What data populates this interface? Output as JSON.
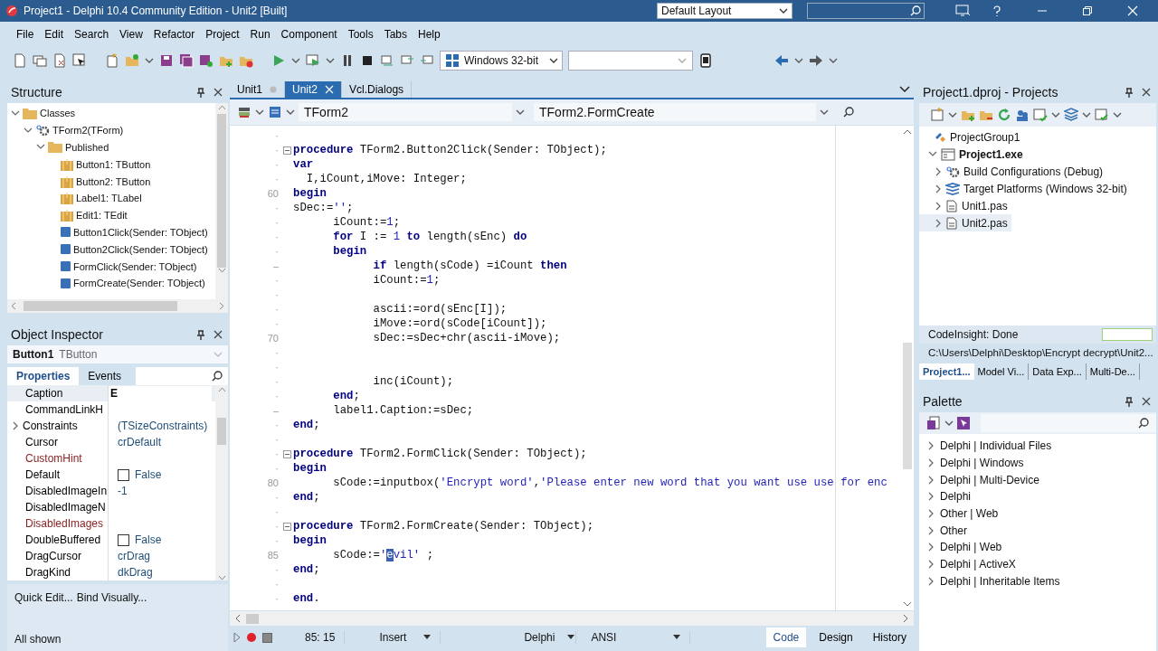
{
  "window": {
    "title": "Project1 - Delphi 10.4 Community Edition - Unit2 [Built]",
    "layout": "Default Layout"
  },
  "menu": [
    "File",
    "Edit",
    "Search",
    "View",
    "Refactor",
    "Project",
    "Run",
    "Component",
    "Tools",
    "Tabs",
    "Help"
  ],
  "toolbar": {
    "platform": "Windows 32-bit"
  },
  "structure": {
    "title": "Structure",
    "tree": [
      {
        "label": "Classes",
        "kind": "folder",
        "expanded": true,
        "children": [
          {
            "label": "TForm2(TForm)",
            "kind": "class",
            "expanded": true,
            "children": [
              {
                "label": "Published",
                "kind": "folder",
                "expanded": true,
                "children": [
                  {
                    "label": "Button1: TButton",
                    "kind": "component"
                  },
                  {
                    "label": "Button2: TButton",
                    "kind": "component"
                  },
                  {
                    "label": "Label1: TLabel",
                    "kind": "component"
                  },
                  {
                    "label": "Edit1: TEdit",
                    "kind": "component"
                  },
                  {
                    "label": "Button1Click(Sender: TObject)",
                    "kind": "method"
                  },
                  {
                    "label": "Button2Click(Sender: TObject)",
                    "kind": "method"
                  },
                  {
                    "label": "FormClick(Sender: TObject)",
                    "kind": "method"
                  },
                  {
                    "label": "FormCreate(Sender: TObject)",
                    "kind": "method"
                  }
                ]
              }
            ]
          }
        ]
      }
    ]
  },
  "inspector": {
    "title": "Object Inspector",
    "object": {
      "name": "Button1",
      "type": "TButton"
    },
    "tabs": [
      {
        "label": "Properties",
        "selected": true
      },
      {
        "label": "Events",
        "selected": false
      }
    ],
    "properties": [
      {
        "name": "Caption",
        "value": "E",
        "kind": "text",
        "selected": true,
        "expandable": false,
        "color": "#000000"
      },
      {
        "name": "CommandLinkH",
        "kind": "text",
        "selected": false,
        "expandable": false,
        "color": "#000000"
      },
      {
        "name": "Constraints",
        "value": "(TSizeConstraints)",
        "kind": "text",
        "selected": false,
        "expandable": true,
        "color": "#000000"
      },
      {
        "name": "Cursor",
        "value": "crDefault",
        "kind": "text",
        "selected": false,
        "expandable": false,
        "color": "#000000"
      },
      {
        "name": "CustomHint",
        "kind": "text",
        "selected": false,
        "expandable": false,
        "color": "#8b2323"
      },
      {
        "name": "Default",
        "value": "False",
        "kind": "checkbox",
        "checked": false,
        "selected": false,
        "expandable": false,
        "color": "#000000"
      },
      {
        "name": "DisabledImageIn",
        "value": "-1",
        "kind": "text",
        "selected": false,
        "expandable": false,
        "color": "#000000"
      },
      {
        "name": "DisabledImageN",
        "kind": "text",
        "selected": false,
        "expandable": false,
        "color": "#000000"
      },
      {
        "name": "DisabledImages",
        "kind": "text",
        "selected": false,
        "expandable": false,
        "color": "#8b2323"
      },
      {
        "name": "DoubleBuffered",
        "value": "False",
        "kind": "checkbox",
        "checked": false,
        "selected": false,
        "expandable": false,
        "color": "#000000"
      },
      {
        "name": "DragCursor",
        "value": "crDrag",
        "kind": "text",
        "selected": false,
        "expandable": false,
        "color": "#000000"
      },
      {
        "name": "DragKind",
        "value": "dkDrag",
        "kind": "text",
        "selected": false,
        "expandable": false,
        "color": "#000000"
      }
    ],
    "links": [
      "Quick Edit...",
      "Bind Visually..."
    ],
    "status": "All shown"
  },
  "editor": {
    "tabs": [
      {
        "label": "Unit1",
        "selected": false,
        "modified": true
      },
      {
        "label": "Unit2",
        "selected": true,
        "modified": false
      },
      {
        "label": "Vcl.Dialogs",
        "selected": false,
        "modified": false
      }
    ],
    "class_combo": "TForm2",
    "method_combo": "TForm2.FormCreate",
    "lines": [
      {
        "gutter": "·",
        "fold": false
      },
      {
        "gutter": "·",
        "fold": true,
        "tokens": [
          {
            "kind": "kw",
            "text": "procedure"
          },
          {
            "kind": "plain",
            "text": " TForm2.Button2Click(Sender: TObject);"
          }
        ]
      },
      {
        "gutter": "·",
        "fold": false,
        "tokens": [
          {
            "kind": "kw",
            "text": "var"
          }
        ]
      },
      {
        "gutter": "·",
        "fold": false,
        "tokens": [
          {
            "kind": "plain",
            "text": "  I,iCount,iMove: Integer;"
          }
        ]
      },
      {
        "gutter": "60",
        "fold": false,
        "tokens": [
          {
            "kind": "kw",
            "text": "begin"
          }
        ]
      },
      {
        "gutter": "·",
        "fold": false,
        "tokens": [
          {
            "kind": "plain",
            "text": "sDec:="
          },
          {
            "kind": "str",
            "text": "''"
          },
          {
            "kind": "plain",
            "text": ";"
          }
        ]
      },
      {
        "gutter": "·",
        "fold": false,
        "tokens": [
          {
            "kind": "plain",
            "text": "      iCount:="
          },
          {
            "kind": "num",
            "text": "1"
          },
          {
            "kind": "plain",
            "text": ";"
          }
        ]
      },
      {
        "gutter": "·",
        "fold": false,
        "tokens": [
          {
            "kind": "kw",
            "text": "      for"
          },
          {
            "kind": "plain",
            "text": " I := "
          },
          {
            "kind": "num",
            "text": "1"
          },
          {
            "kind": "kw",
            "text": " to"
          },
          {
            "kind": "plain",
            "text": " length(sEnc) "
          },
          {
            "kind": "kw",
            "text": "do"
          }
        ]
      },
      {
        "gutter": "·",
        "fold": false,
        "tokens": [
          {
            "kind": "kw",
            "text": "      begin"
          }
        ]
      },
      {
        "gutter": "–",
        "fold": false,
        "tokens": [
          {
            "kind": "kw",
            "text": "            if"
          },
          {
            "kind": "plain",
            "text": " length(sCode) =iCount "
          },
          {
            "kind": "kw",
            "text": "then"
          }
        ]
      },
      {
        "gutter": "·",
        "fold": false,
        "tokens": [
          {
            "kind": "plain",
            "text": "            iCount:="
          },
          {
            "kind": "num",
            "text": "1"
          },
          {
            "kind": "plain",
            "text": ";"
          }
        ]
      },
      {
        "gutter": "·",
        "fold": false
      },
      {
        "gutter": "·",
        "fold": false,
        "tokens": [
          {
            "kind": "plain",
            "text": "            ascii:=ord(sEnc[I]);"
          }
        ]
      },
      {
        "gutter": "·",
        "fold": false,
        "tokens": [
          {
            "kind": "plain",
            "text": "            iMove:=ord(sCode[iCount]);"
          }
        ]
      },
      {
        "gutter": "70",
        "fold": false,
        "tokens": [
          {
            "kind": "plain",
            "text": "            sDec:=sDec+chr(ascii-iMove);"
          }
        ]
      },
      {
        "gutter": "·",
        "fold": false
      },
      {
        "gutter": "·",
        "fold": false
      },
      {
        "gutter": "·",
        "fold": false,
        "tokens": [
          {
            "kind": "plain",
            "text": "            inc(iCount);"
          }
        ]
      },
      {
        "gutter": "·",
        "fold": false,
        "tokens": [
          {
            "kind": "kw",
            "text": "      end"
          },
          {
            "kind": "plain",
            "text": ";"
          }
        ]
      },
      {
        "gutter": "–",
        "fold": false,
        "tokens": [
          {
            "kind": "plain",
            "text": "      label1.Caption:=sDec;"
          }
        ]
      },
      {
        "gutter": "·",
        "fold": false,
        "tokens": [
          {
            "kind": "kw",
            "text": "end"
          },
          {
            "kind": "plain",
            "text": ";"
          }
        ]
      },
      {
        "gutter": "·",
        "fold": false
      },
      {
        "gutter": "·",
        "fold": true,
        "tokens": [
          {
            "kind": "kw",
            "text": "procedure"
          },
          {
            "kind": "plain",
            "text": " TForm2.FormClick(Sender: TObject);"
          }
        ]
      },
      {
        "gutter": "·",
        "fold": false,
        "tokens": [
          {
            "kind": "kw",
            "text": "begin"
          }
        ]
      },
      {
        "gutter": "80",
        "fold": false,
        "tokens": [
          {
            "kind": "plain",
            "text": "      sCode:=inputbox("
          },
          {
            "kind": "str",
            "text": "'Encrypt word'"
          },
          {
            "kind": "plain",
            "text": ","
          },
          {
            "kind": "str",
            "text": "'Please enter new word that you want use use for enc"
          }
        ]
      },
      {
        "gutter": "·",
        "fold": false,
        "tokens": [
          {
            "kind": "kw",
            "text": "end"
          },
          {
            "kind": "plain",
            "text": ";"
          }
        ]
      },
      {
        "gutter": "·",
        "fold": false
      },
      {
        "gutter": "·",
        "fold": true,
        "tokens": [
          {
            "kind": "kw",
            "text": "procedure"
          },
          {
            "kind": "plain",
            "text": " TForm2.FormCreate(Sender: TObject);"
          }
        ]
      },
      {
        "gutter": "·",
        "fold": false,
        "tokens": [
          {
            "kind": "kw",
            "text": "begin"
          }
        ]
      },
      {
        "gutter": "85",
        "fold": false,
        "tokens": [
          {
            "kind": "plain",
            "text": "      sCode:="
          },
          {
            "kind": "str",
            "text": "'"
          },
          {
            "kind": "sel",
            "text": "e"
          },
          {
            "kind": "str",
            "text": "vil'"
          },
          {
            "kind": "plain",
            "text": " ;"
          }
        ]
      },
      {
        "gutter": "·",
        "fold": false,
        "tokens": [
          {
            "kind": "kw",
            "text": "end"
          },
          {
            "kind": "plain",
            "text": ";"
          }
        ]
      },
      {
        "gutter": "·",
        "fold": false
      },
      {
        "gutter": "·",
        "fold": false,
        "tokens": [
          {
            "kind": "kw",
            "text": "end"
          },
          {
            "kind": "plain",
            "text": "."
          }
        ]
      }
    ],
    "status": {
      "position": "85: 15",
      "mode": "Insert",
      "language": "Delphi",
      "encoding": "ANSI"
    },
    "views": [
      {
        "label": "Code",
        "selected": true
      },
      {
        "label": "Design",
        "selected": false
      },
      {
        "label": "History",
        "selected": false
      }
    ]
  },
  "projects": {
    "title": "Project1.dproj - Projects",
    "tree": [
      {
        "label": "ProjectGroup1",
        "kind": "group",
        "selected": false,
        "children": [
          {
            "label": "Project1.exe",
            "kind": "project",
            "expanded": true,
            "selected": false,
            "children": [
              {
                "label": "Build Configurations (Debug)",
                "kind": "config",
                "expanded": false,
                "selected": false
              },
              {
                "label": "Target Platforms (Windows 32-bit)",
                "kind": "platforms",
                "expanded": false,
                "selected": false
              },
              {
                "label": "Unit1.pas",
                "kind": "file",
                "expanded": false,
                "selected": false
              },
              {
                "label": "Unit2.pas",
                "kind": "file",
                "expanded": false,
                "selected": true
              }
            ]
          }
        ]
      }
    ],
    "codeinsight": "CodeInsight: Done",
    "path": "C:\\Users\\Delphi\\Desktop\\Encrypt decrypt\\Unit2...",
    "tabs": [
      {
        "label": "Project1...",
        "selected": true
      },
      {
        "label": "Model Vi...",
        "selected": false
      },
      {
        "label": "Data Exp...",
        "selected": false
      },
      {
        "label": "Multi-De...",
        "selected": false
      }
    ]
  },
  "palette": {
    "title": "Palette",
    "categories": [
      "Delphi | Individual Files",
      "Delphi | Windows",
      "Delphi | Multi-Device",
      "Delphi",
      "Other | Web",
      "Other",
      "Delphi | Web",
      "Delphi | ActiveX",
      "Delphi | Inheritable Items"
    ]
  }
}
